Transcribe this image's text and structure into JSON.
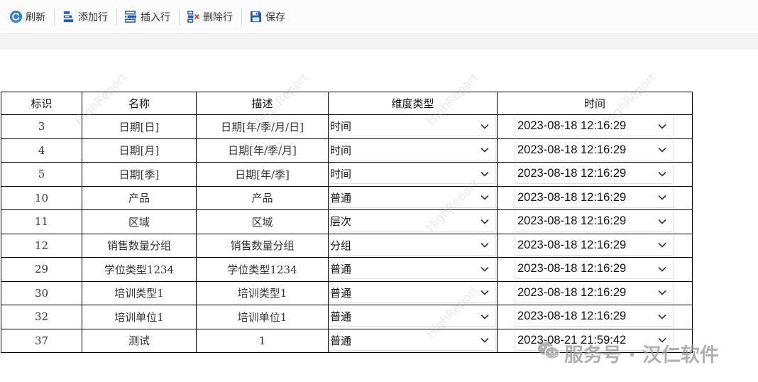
{
  "toolbar": {
    "refresh_label": "刷新",
    "add_row_label": "添加行",
    "insert_row_label": "插入行",
    "delete_row_label": "删除行",
    "save_label": "保存"
  },
  "table": {
    "headers": [
      "标识",
      "名称",
      "描述",
      "维度类型",
      "时间"
    ],
    "rows": [
      {
        "id": "3",
        "name": "日期[日]",
        "desc": "日期[年/季/月/日]",
        "type": "时间",
        "time": "2023-08-18 12:16:29"
      },
      {
        "id": "4",
        "name": "日期[月]",
        "desc": "日期[年/季/月]",
        "type": "时间",
        "time": "2023-08-18 12:16:29"
      },
      {
        "id": "5",
        "name": "日期[季]",
        "desc": "日期[年/季]",
        "type": "时间",
        "time": "2023-08-18 12:16:29"
      },
      {
        "id": "10",
        "name": "产品",
        "desc": "产品",
        "type": "普通",
        "time": "2023-08-18 12:16:29"
      },
      {
        "id": "11",
        "name": "区域",
        "desc": "区域",
        "type": "层次",
        "time": "2023-08-18 12:16:29"
      },
      {
        "id": "12",
        "name": "销售数量分组",
        "desc": "销售数量分组",
        "type": "分组",
        "time": "2023-08-18 12:16:29"
      },
      {
        "id": "29",
        "name": "学位类型1234",
        "desc": "学位类型1234",
        "type": "普通",
        "time": "2023-08-18 12:16:29"
      },
      {
        "id": "30",
        "name": "培训类型1",
        "desc": "培训类型1",
        "type": "普通",
        "time": "2023-08-18 12:16:29"
      },
      {
        "id": "32",
        "name": "培训单位1",
        "desc": "培训单位1",
        "type": "普通",
        "time": "2023-08-18 12:16:29"
      },
      {
        "id": "37",
        "name": "测试",
        "desc": "1",
        "type": "普通",
        "time": "2023-08-21 21:59:42"
      }
    ]
  },
  "watermark": {
    "text": "HighReport",
    "brand": "服务号 · 汉仁软件"
  },
  "colors": {
    "refresh_icon": "#2f7fd8",
    "add_icon": "#2a5aa8",
    "delete_mark": "#e0403a",
    "save_icon": "#2a5aa8",
    "grid_border": "#000000"
  },
  "icons": [
    "refresh-icon",
    "add-row-icon",
    "insert-row-icon",
    "delete-row-icon",
    "save-icon",
    "chevron-down-icon",
    "wechat-icon"
  ]
}
